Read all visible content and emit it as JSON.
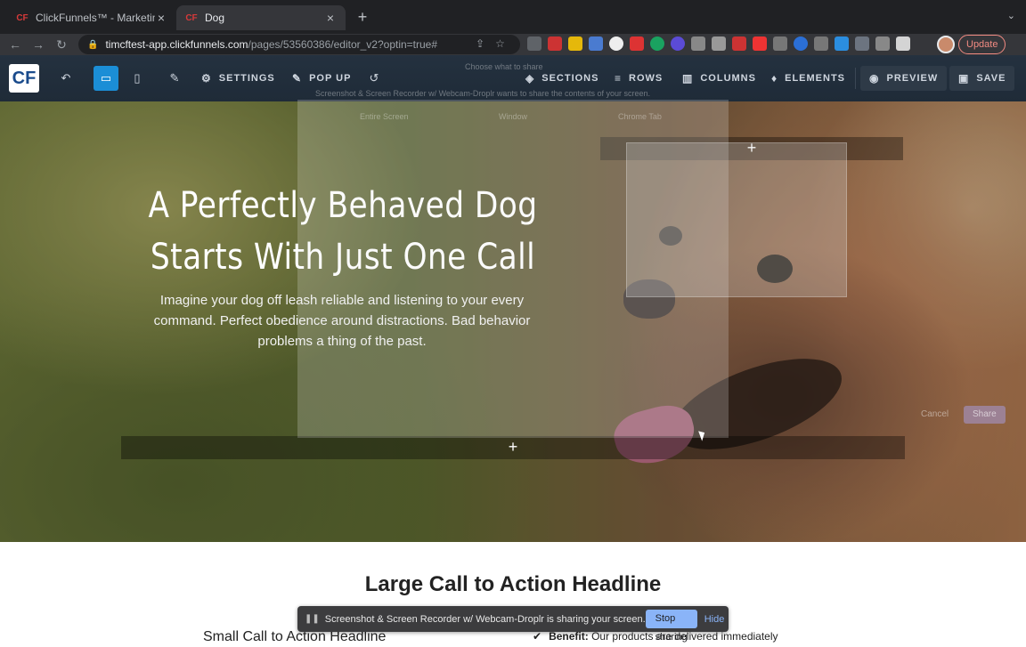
{
  "browser": {
    "tabs": [
      {
        "title": "ClickFunnels™ - Marketing Fun",
        "active": false
      },
      {
        "title": "Dog",
        "active": true
      }
    ],
    "url_host": "timcftest-app.clickfunnels.com",
    "url_path": "/pages/53560386/editor_v2?optin=true#",
    "update_label": "Update"
  },
  "editor": {
    "settings": "SETTINGS",
    "popup": "POP UP",
    "sections": "SECTIONS",
    "rows": "ROWS",
    "columns": "COLUMNS",
    "elements": "ELEMENTS",
    "preview": "PREVIEW",
    "save": "SAVE"
  },
  "hero": {
    "title_line1": "A Perfectly Behaved Dog",
    "title_line2": "Starts With Just One Call",
    "subtitle": "Imagine your dog off leash reliable and listening to your every command. Perfect obedience around distractions. Bad behavior problems a thing of the past.",
    "add_icon": "+"
  },
  "share_dialog": {
    "title": "Choose what to share",
    "description": "Screenshot & Screen Recorder w/ Webcam-Droplr wants to share the contents of your screen.",
    "tabs": [
      "Entire Screen",
      "Window",
      "Chrome Tab"
    ],
    "cancel": "Cancel",
    "share": "Share"
  },
  "lower": {
    "cta_headline": "Large Call to Action Headline",
    "small_cta": "Small Call to Action Headline",
    "benefit_label": "Benefit:",
    "benefit_text": "Our products are delivered immediately"
  },
  "sharing_bar": {
    "message": "Screenshot & Screen Recorder w/ Webcam-Droplr is sharing your screen.",
    "stop": "Stop sharing",
    "hide": "Hide"
  },
  "colors": {
    "editor_bar": "#24313f",
    "active_device": "#1b8ed6",
    "stop_button": "#8ab4f8",
    "update_border": "#f28b82"
  }
}
